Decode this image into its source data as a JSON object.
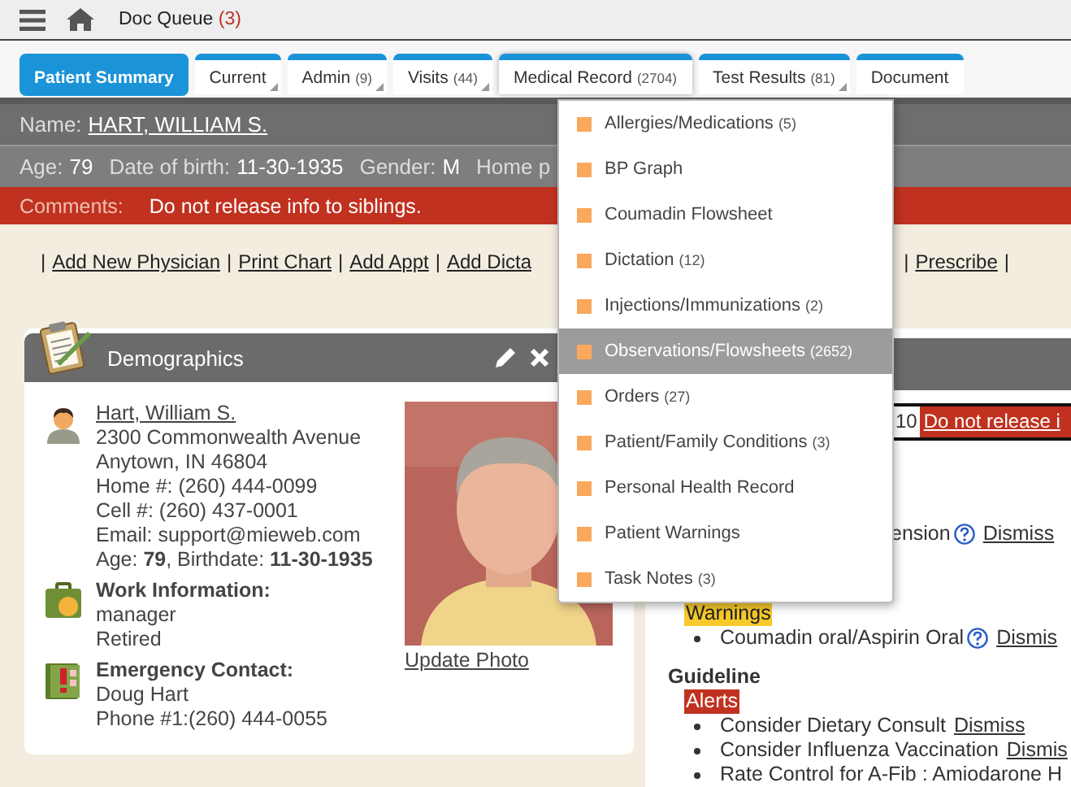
{
  "top_bar": {
    "title": "Doc Queue",
    "count": "(3)"
  },
  "tabs": [
    {
      "label": "Patient Summary",
      "kind": "plain",
      "selected": true,
      "open": false
    },
    {
      "label": "Current",
      "kind": "menu",
      "selected": false,
      "open": false
    },
    {
      "label": "Admin",
      "count": "(9)",
      "kind": "menu",
      "selected": false,
      "open": false
    },
    {
      "label": "Visits",
      "count": "(44)",
      "kind": "menu",
      "selected": false,
      "open": false
    },
    {
      "label": "Medical Record",
      "count": "(2704)",
      "kind": "menu",
      "selected": false,
      "open": true
    },
    {
      "label": "Test Results",
      "count": "(81)",
      "kind": "menu",
      "selected": false,
      "open": false
    },
    {
      "label": "Document",
      "kind": "plain",
      "selected": false,
      "open": false
    }
  ],
  "menu": [
    {
      "label": "Allergies/Medications",
      "count": "(5)",
      "selected": false
    },
    {
      "label": "BP Graph",
      "selected": false
    },
    {
      "label": "Coumadin Flowsheet",
      "selected": false
    },
    {
      "label": "Dictation",
      "count": "(12)",
      "selected": false
    },
    {
      "label": "Injections/Immunizations",
      "count": "(2)",
      "selected": false
    },
    {
      "label": "Observations/Flowsheets",
      "count": "(2652)",
      "selected": true
    },
    {
      "label": "Orders",
      "count": "(27)",
      "selected": false
    },
    {
      "label": "Patient/Family Conditions",
      "count": "(3)",
      "selected": false
    },
    {
      "label": "Personal Health Record",
      "selected": false
    },
    {
      "label": "Patient Warnings",
      "selected": false
    },
    {
      "label": "Task Notes",
      "count": "(3)",
      "selected": false
    }
  ],
  "patient": {
    "name_label": "Name:",
    "name": "HART, WILLIAM S.",
    "info": [
      {
        "label": "Age:",
        "value": "79"
      },
      {
        "label": "Date of birth:",
        "value": "11-30-1935"
      },
      {
        "label": "Gender:",
        "value": "M"
      },
      {
        "label": "Home p"
      }
    ],
    "comments_label": "Comments:",
    "comments": "Do not release info to siblings."
  },
  "links_left": [
    {
      "kind": "sep",
      "text": "|"
    },
    {
      "kind": "link",
      "text": "Add New Physician"
    },
    {
      "kind": "sep",
      "text": "|"
    },
    {
      "kind": "link",
      "text": "Print Chart"
    },
    {
      "kind": "sep",
      "text": "|"
    },
    {
      "kind": "link",
      "text": "Add Appt"
    },
    {
      "kind": "sep",
      "text": "|"
    },
    {
      "kind": "link",
      "text": "Add Dicta"
    }
  ],
  "links_right": [
    {
      "kind": "sep",
      "text": "|"
    },
    {
      "kind": "link",
      "text": "Prescribe"
    },
    {
      "kind": "sep",
      "text": "|"
    }
  ],
  "demographics": {
    "title": "Demographics",
    "name": "Hart, William S.",
    "lines": [
      "2300 Commonwealth Avenue",
      "Anytown, IN 46804",
      "Home #: (260) 444-0099",
      "Cell #: (260) 437-0001",
      "Email: support@mieweb.com",
      "Age: **79**, Birthdate: **11-30-1935**"
    ],
    "sections": [
      {
        "kind": "work",
        "title": "Work Information:",
        "lines": [
          "manager",
          "Retired"
        ]
      },
      {
        "kind": "emergency",
        "title": "Emergency Contact:",
        "lines": [
          "Doug Hart",
          "Phone #1:(260) 444-0055"
        ]
      }
    ],
    "photo_link": "Update Photo"
  },
  "alerts": {
    "comments_date": "10",
    "comments_text": "Do not release i",
    "entries": [
      {
        "kind": "line",
        "text": "ension",
        "help": true,
        "action": "Dismiss"
      },
      {
        "kind": "tag",
        "text": "Warnings",
        "color": "#f7c92a"
      },
      {
        "kind": "bullet",
        "text": "Coumadin oral/Aspirin Oral",
        "help": true,
        "action": "Dismis"
      },
      {
        "kind": "heading",
        "text": "Guideline"
      },
      {
        "kind": "tag",
        "text": "Alerts",
        "color": "#c0321f"
      },
      {
        "kind": "bullet",
        "text": "Consider Dietary Consult",
        "help": false,
        "action": "Dismiss"
      },
      {
        "kind": "bullet",
        "text": "Consider Influenza Vaccination",
        "help": false,
        "action": "Dismis"
      },
      {
        "kind": "bullet",
        "text": "Rate Control for A-Fib : Amiodarone H",
        "help": false
      }
    ]
  }
}
